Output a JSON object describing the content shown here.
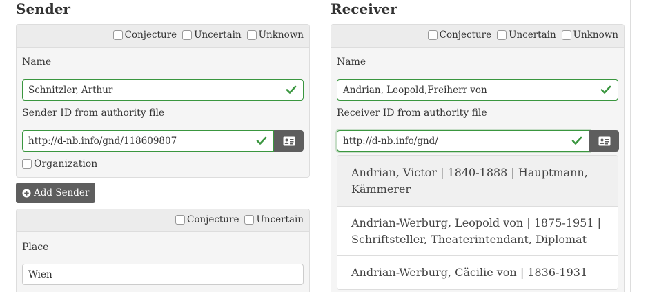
{
  "sender": {
    "heading": "Sender",
    "flags": [
      "Conjecture",
      "Uncertain",
      "Unknown"
    ],
    "name_label": "Name",
    "name_value": "Schnitzler, Arthur",
    "id_label": "Sender ID from authority file",
    "id_value": "http://d-nb.info/gnd/118609807",
    "organization_label": "Organization",
    "add_button": "Add Sender"
  },
  "place": {
    "flags": [
      "Conjecture",
      "Uncertain"
    ],
    "label": "Place",
    "value": "Wien"
  },
  "receiver": {
    "heading": "Receiver",
    "flags": [
      "Conjecture",
      "Uncertain",
      "Unknown"
    ],
    "name_label": "Name",
    "name_value": "Andrian, Leopold,Freiherr von",
    "id_label": "Receiver ID from authority file",
    "id_value": "http://d-nb.info/gnd/",
    "suggestions": [
      "Andrian, Victor | 1840-1888 | Hauptmann, Kämmerer",
      "Andrian-Werburg, Leopold von | 1875-1951 | Schriftsteller, Theaterintendant, Diplomat",
      "Andrian-Werburg, Cäcilie von | 1836-1931"
    ]
  },
  "colors": {
    "valid": "#3a963f",
    "button": "#5e5e5e"
  }
}
